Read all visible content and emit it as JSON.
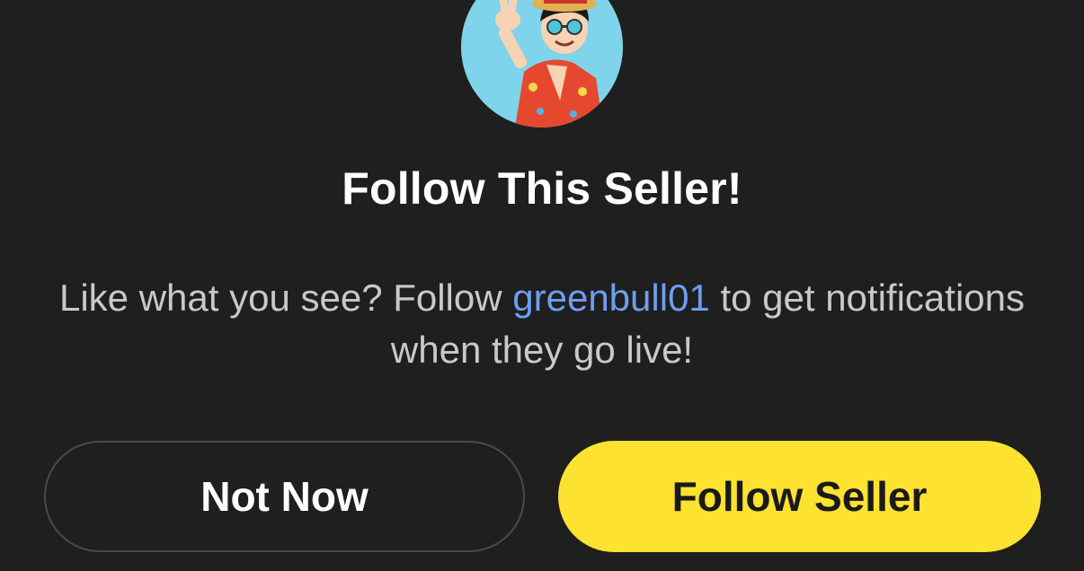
{
  "dialog": {
    "title": "Follow This Seller!",
    "message_before": "Like what you see? Follow ",
    "username": "greenbull01",
    "message_after": " to get notifications when they go live!",
    "secondary_button_label": "Not Now",
    "primary_button_label": "Follow Seller"
  },
  "colors": {
    "background": "#1f1f1f",
    "username_link": "#6f9ef0",
    "primary_button": "#fde22f"
  },
  "icons": {
    "avatar": "seller-avatar-image"
  }
}
